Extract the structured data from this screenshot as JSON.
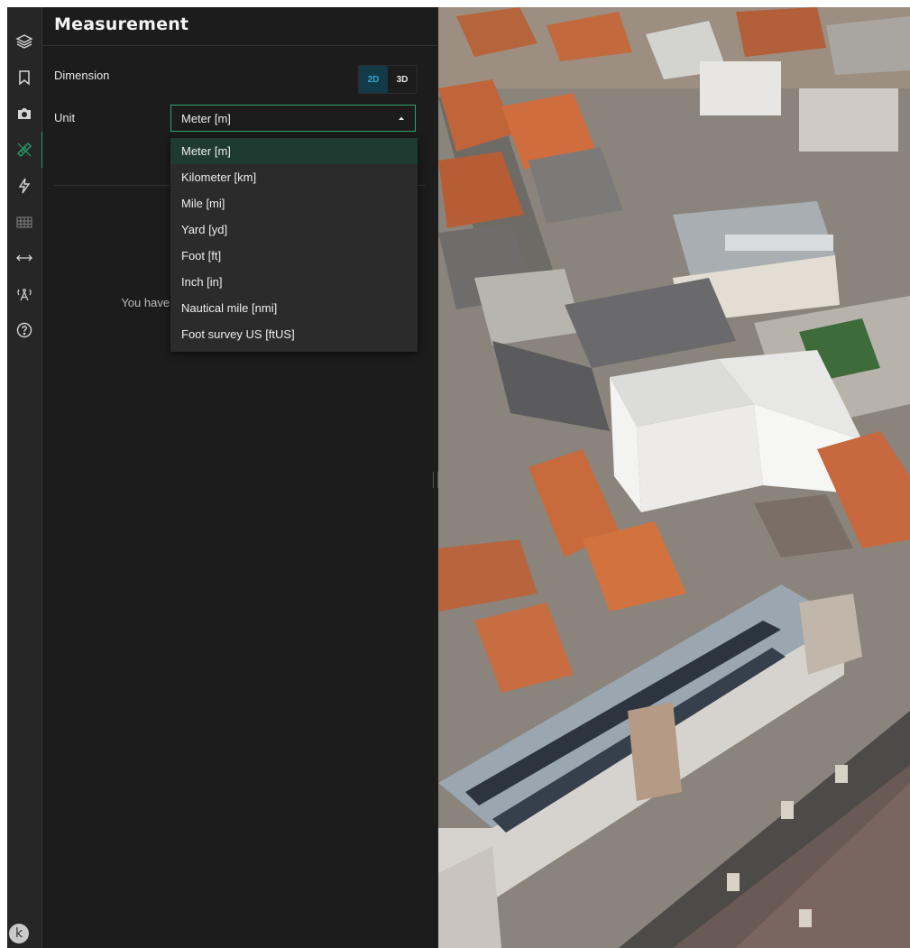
{
  "panel": {
    "title": "Measurement",
    "dimension_label": "Dimension",
    "dimension_options": [
      "2D",
      "3D"
    ],
    "dimension_selected": "2D",
    "unit_label": "Unit",
    "unit_selected": "Meter [m]",
    "empty_message": "You have r"
  },
  "unit_menu": {
    "items": [
      "Meter [m]",
      "Kilometer [km]",
      "Mile [mi]",
      "Yard [yd]",
      "Foot [ft]",
      "Inch [in]",
      "Nautical mile [nmi]",
      "Foot survey US [ftUS]"
    ],
    "selected_index": 0
  },
  "rail": {
    "icons": [
      "layers-icon",
      "bookmark-icon",
      "camera-icon",
      "measurement-icon",
      "energy-icon",
      "building-icon",
      "distance-icon",
      "antenna-icon",
      "help-icon"
    ],
    "active": "measurement-icon"
  },
  "user": {
    "initial": "k"
  },
  "colors": {
    "accent": "#22a06b",
    "toggle_active_bg": "#133a47",
    "toggle_active_text": "#2aa7d0",
    "panel_bg": "#1c1c1c"
  }
}
